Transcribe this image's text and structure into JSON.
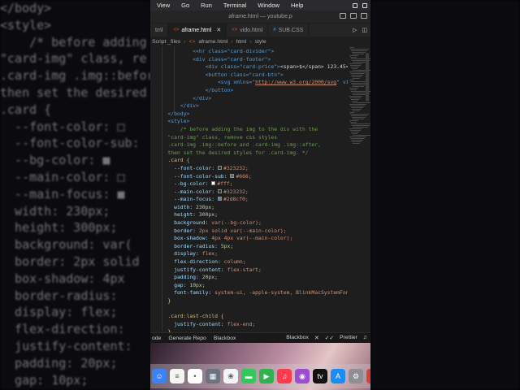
{
  "menubar": {
    "items": [
      "View",
      "Go",
      "Run",
      "Terminal",
      "Window",
      "Help"
    ]
  },
  "window": {
    "title": "aframe.html — youtube.p"
  },
  "tabs": [
    {
      "label": "tml",
      "active": false
    },
    {
      "label": "aframe.html",
      "active": true
    },
    {
      "label": "vido.html",
      "active": false
    },
    {
      "label": "SUB.CSS",
      "active": false
    }
  ],
  "breadcrumb": [
    "Script _files",
    "aframe.html",
    "html",
    "style"
  ],
  "status": {
    "left": [
      "ode",
      "Generate Repo",
      "Blackbox"
    ],
    "right": [
      "Blackbox",
      "Prettier"
    ]
  },
  "background_left": [
    "</body>",
    "<style>",
    "    /* before adding",
    "\"card-img\" class, re",
    ".card-img .img::before",
    "then set the desired",
    ".card {",
    "  --font-color: □",
    "  --font-color-sub:",
    "  --bg-color: ■",
    "  --main-color: □",
    "  --main-focus: ■",
    "  width: 230px;",
    "  height: 300px;",
    "  background: var(",
    "  border: 2px solid",
    "  box-shadow: 4px",
    "  border-radius:",
    "  display: flex;",
    "  flex-direction:",
    "  justify-content:",
    "  padding: 20px;",
    "  gap: 10px;"
  ],
  "background_right": [
    "",
    "",
    "",
    "",
    "",
    "",
    "",
    "",
    "",
    "",
    "",
    "",
    "",
    "",
    "",
    "",
    "",
    "",
    "",
    "",
    "",
    "",
    ""
  ],
  "code": {
    "line1": "<hr class=\"card-divider\">",
    "line2": "<div class=\"card-footer\">",
    "line3a": "<div class=\"card-price\">",
    "line3b": "<span>$</span>",
    "line3c": " 123.45</",
    "line4": "<button class=\"card-btn\">",
    "line5a": "<svg xmlns=\"",
    "line5b": "http://www.w3.org/2000/svg",
    "line5c": "\" viewB",
    "line6": "</button>",
    "line7": "</div>",
    "line8": "</div>",
    "line9": "</body>",
    "line10": "<style>",
    "c1": "/* before adding the img to the div with the",
    "c2": "\"card-img\" class, remove css styles",
    "c3": ".card-img .img::before and .card-img .img::after,",
    "c4": "then set the desired styles for .card-img. */",
    "sel": ".card {",
    "v1": [
      "--font-color:",
      "#323232;",
      "#323232"
    ],
    "v2": [
      "--font-color-sub:",
      "#666;",
      "#666666"
    ],
    "v3": [
      "--bg-color:",
      "#fff;",
      "#ffffff"
    ],
    "v4": [
      "--main-color:",
      "#323232;",
      "#323232"
    ],
    "v5": [
      "--main-focus:",
      "#2d8cf0;",
      "#2d8cf0"
    ],
    "p1": [
      "width:",
      "230px;"
    ],
    "p2": [
      "height:",
      "300px;"
    ],
    "p3": [
      "background:",
      "var(--bg-color);"
    ],
    "p4": [
      "border:",
      "2px solid var(--main-color);"
    ],
    "p5": [
      "box-shadow:",
      "4px 4px var(--main-color);"
    ],
    "p6": [
      "border-radius:",
      "5px;"
    ],
    "p7": [
      "display:",
      "flex;"
    ],
    "p8": [
      "flex-direction:",
      "column;"
    ],
    "p9": [
      "justify-content:",
      "flex-start;"
    ],
    "p10": [
      "padding:",
      "20px;"
    ],
    "p11": [
      "gap:",
      "10px;"
    ],
    "p12": [
      "font-family:",
      "system-ui, -apple-system, BlinkMacSystemFont"
    ],
    "close": "}",
    "sel2": ".card:last-child {",
    "p13": [
      "justify-content:",
      "flex-end;"
    ],
    "close2": "}"
  },
  "dock_apps": [
    {
      "name": "finder",
      "color": "#3b82f6",
      "glyph": "☺"
    },
    {
      "name": "notes",
      "color": "#f5f5f0",
      "glyph": "≡"
    },
    {
      "name": "reminders",
      "color": "#ffffff",
      "glyph": "•"
    },
    {
      "name": "launchpad",
      "color": "#6b7280",
      "glyph": "▦"
    },
    {
      "name": "photos",
      "color": "#f3f4f6",
      "glyph": "❀"
    },
    {
      "name": "messages",
      "color": "#34c759",
      "glyph": "▬"
    },
    {
      "name": "facetime",
      "color": "#30b34f",
      "glyph": "▶"
    },
    {
      "name": "music",
      "color": "#fa3c4c",
      "glyph": "♫"
    },
    {
      "name": "podcasts",
      "color": "#9b4dd0",
      "glyph": "◉"
    },
    {
      "name": "tv",
      "color": "#111111",
      "glyph": "tv"
    },
    {
      "name": "app-store",
      "color": "#1c8cf2",
      "glyph": "A"
    },
    {
      "name": "settings",
      "color": "#8e8e93",
      "glyph": "⚙"
    },
    {
      "name": "partial-app",
      "color": "#d43f3f",
      "glyph": ""
    }
  ]
}
